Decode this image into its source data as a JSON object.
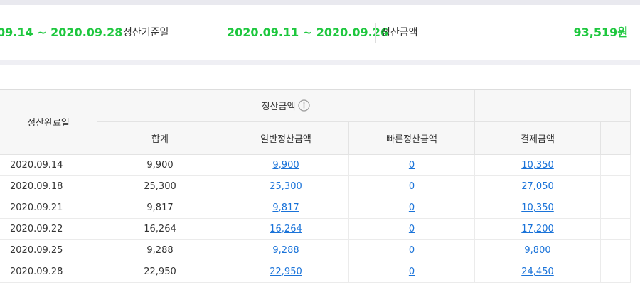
{
  "summary": {
    "period1": "09.14 ~ 2020.09.28",
    "label1": "정산기준일",
    "period2": "2020.09.11 ~ 2020.09.26",
    "label2": "정산금액",
    "amount": "93,519원"
  },
  "table": {
    "headers": {
      "completion_date": "정산완료일",
      "settlement_amount_group": "정산금액",
      "total": "합계",
      "general": "일반정산금액",
      "fast": "빠른정산금액",
      "payment": "결제금액"
    },
    "rows": [
      {
        "date": "2020.09.14",
        "total": "9,900",
        "general": "9,900",
        "fast": "0",
        "payment": "10,350"
      },
      {
        "date": "2020.09.18",
        "total": "25,300",
        "general": "25,300",
        "fast": "0",
        "payment": "27,050"
      },
      {
        "date": "2020.09.21",
        "total": "9,817",
        "general": "9,817",
        "fast": "0",
        "payment": "10,350"
      },
      {
        "date": "2020.09.22",
        "total": "16,264",
        "general": "16,264",
        "fast": "0",
        "payment": "17,200"
      },
      {
        "date": "2020.09.25",
        "total": "9,288",
        "general": "9,288",
        "fast": "0",
        "payment": "9,800"
      },
      {
        "date": "2020.09.28",
        "total": "22,950",
        "general": "22,950",
        "fast": "0",
        "payment": "24,450"
      }
    ]
  },
  "colors": {
    "accent_green": "#1ec73e",
    "link_blue": "#1a73d9"
  },
  "icons": {
    "info": "info-circle-icon"
  }
}
